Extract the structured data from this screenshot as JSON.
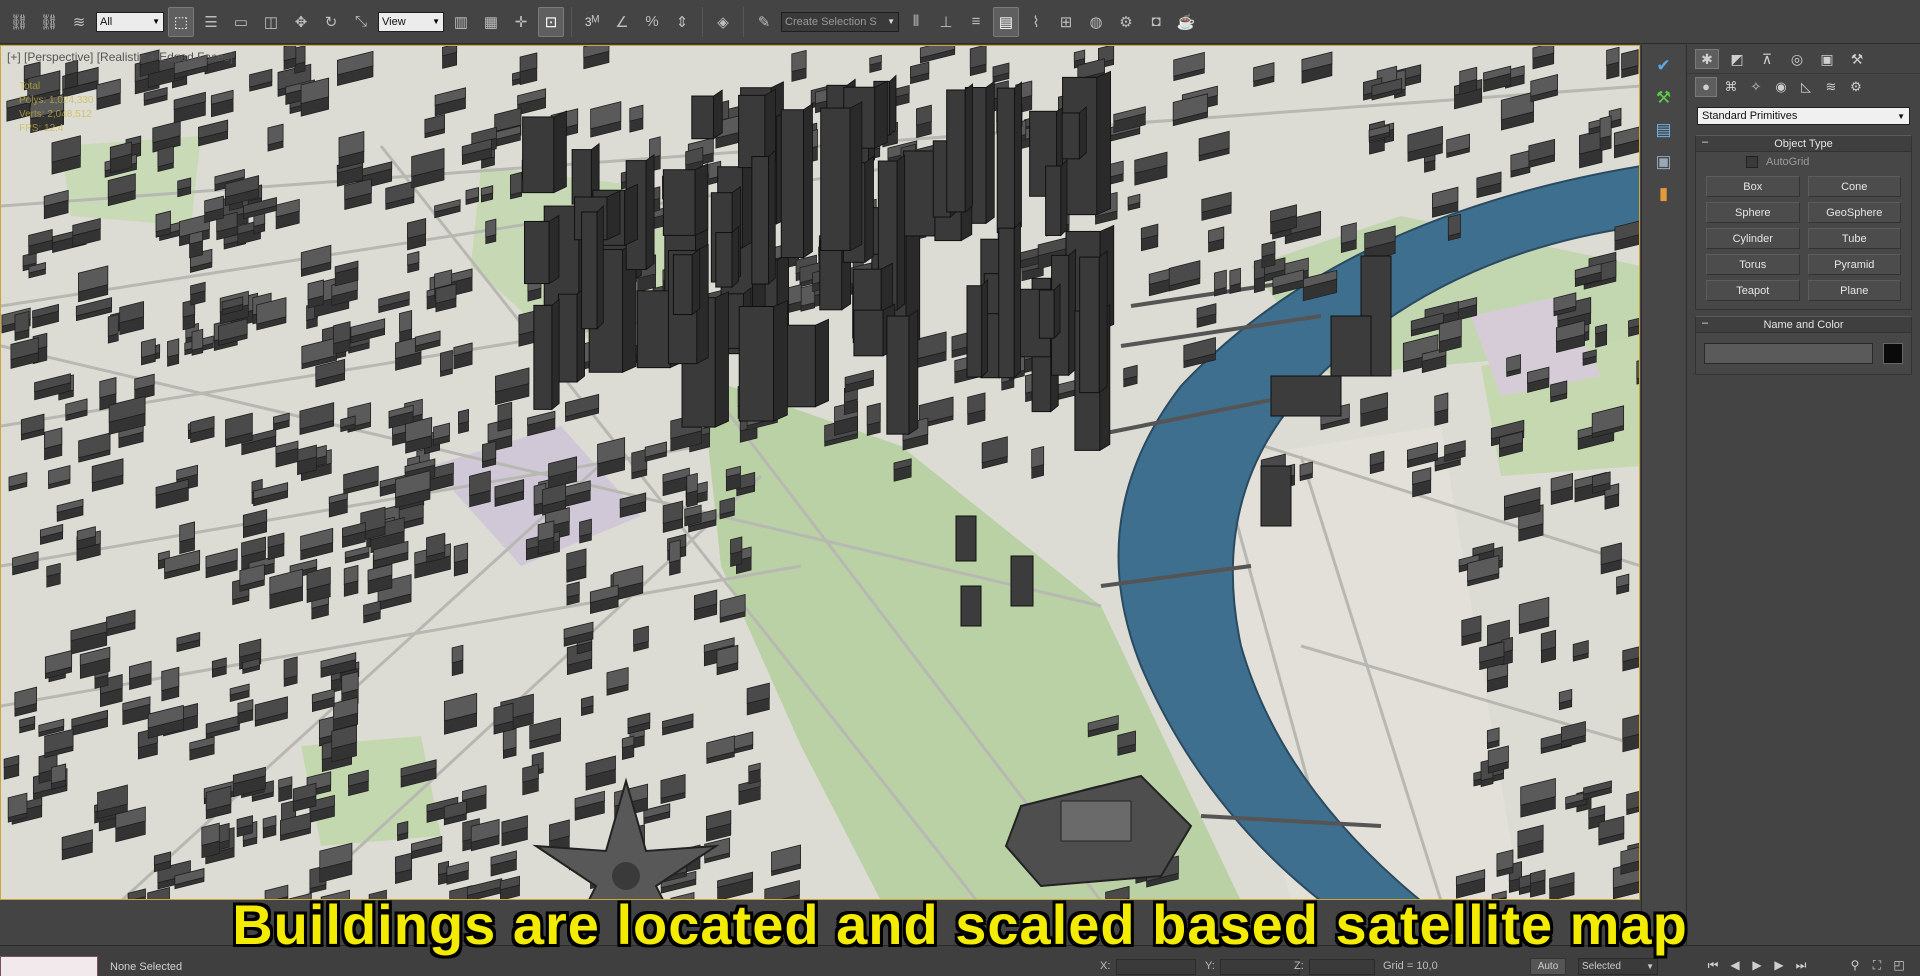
{
  "toolbar": {
    "selection_filter": "All",
    "reference_coord": "View",
    "snap_label": "3",
    "named_selection_placeholder": "Create Selection S",
    "icons": [
      "link-icon",
      "unlink-icon",
      "bind-icon",
      "select-object-icon",
      "select-by-name-icon",
      "rect-region-icon",
      "window-crossing-icon",
      "move-icon",
      "rotate-icon",
      "scale-icon",
      "pivot-icon",
      "select-manipulate-icon",
      "keyboard-shortcut-icon",
      "snaps-toggle-icon",
      "angle-snap-icon",
      "percent-snap-icon",
      "spinner-snap-icon",
      "edit-named-sel-icon",
      "mirror-icon",
      "align-icon",
      "layer-explorer-icon",
      "scene-explorer-icon",
      "curve-editor-icon",
      "schematic-view-icon",
      "material-editor-icon",
      "render-setup-icon",
      "render-frame-icon",
      "render-icon",
      "teapot-render-icon"
    ]
  },
  "viewport": {
    "label": "[+] [Perspective] [Realistic + Edged Faces]",
    "stats": [
      "Total",
      "Polys: 1,024,330",
      "Verts: 2,048,512",
      "FPS: 12.4"
    ],
    "colors": {
      "ground": "#ddddd6",
      "park": "#b8d0a4",
      "river": "#3e6e8e",
      "building": "#4a4a4a",
      "road": "#c8c8c4",
      "frame": "#caa63c"
    }
  },
  "command_panel": {
    "tabs": [
      "create-tab",
      "modify-tab",
      "hierarchy-tab",
      "motion-tab",
      "display-tab",
      "utilities-tab"
    ],
    "categories": [
      "geometry",
      "shapes",
      "lights",
      "cameras",
      "helpers",
      "space-warps",
      "systems"
    ],
    "primitive_type": "Standard Primitives",
    "object_type": {
      "title": "Object Type",
      "autogrid": "AutoGrid",
      "buttons": [
        "Box",
        "Cone",
        "Sphere",
        "GeoSphere",
        "Cylinder",
        "Tube",
        "Torus",
        "Pyramid",
        "Teapot",
        "Plane"
      ]
    },
    "name_and_color": {
      "title": "Name and Color",
      "name_value": ""
    }
  },
  "status": {
    "selection": "None Selected",
    "x_label": "X:",
    "y_label": "Y:",
    "z_label": "Z:",
    "grid": "Grid = 10,0",
    "auto_key": "Auto",
    "set_key_filter": "Selected"
  },
  "caption": "Buildings are located and scaled based satellite map"
}
